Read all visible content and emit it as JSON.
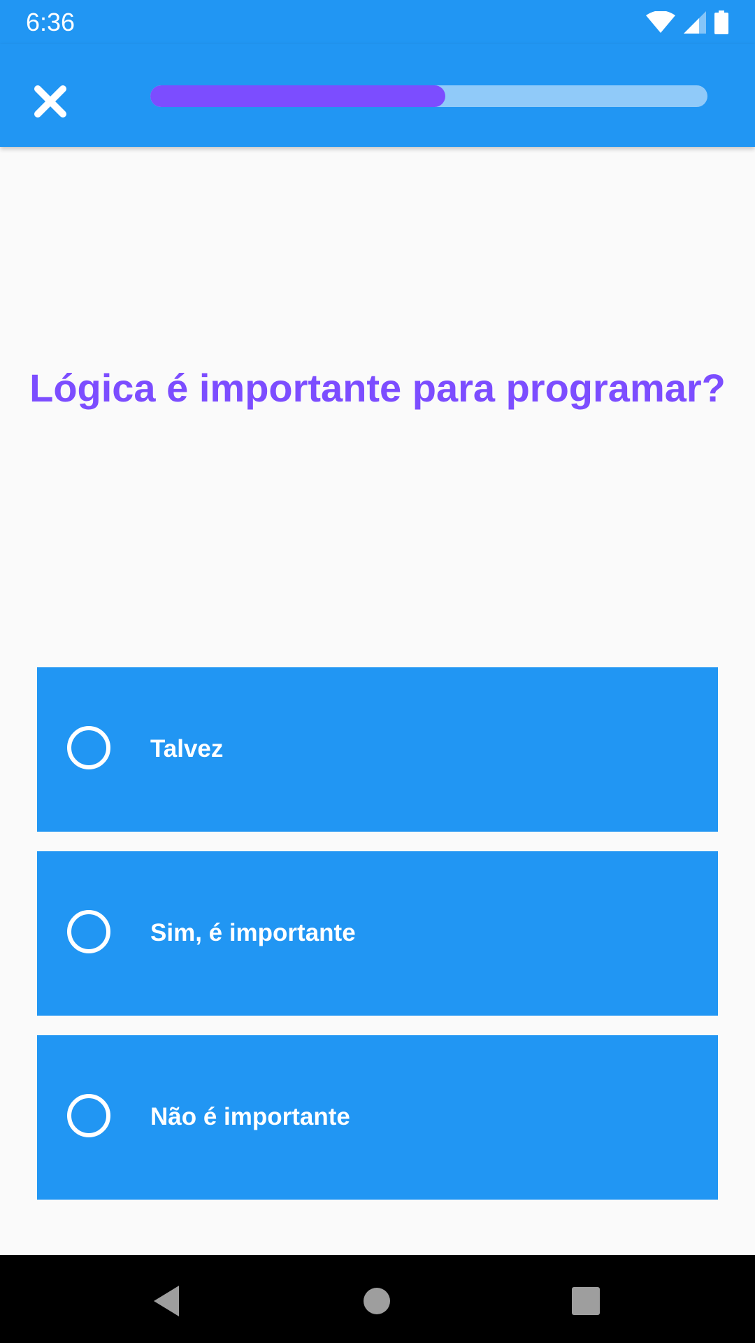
{
  "status_bar": {
    "time": "6:36",
    "icons": [
      "wifi-icon",
      "signal-icon",
      "battery-icon"
    ]
  },
  "app_bar": {
    "close_icon": "close-icon",
    "progress_fraction": 0.53,
    "progress_color": "#7c4dff",
    "progress_track_color": "#90caf9",
    "background_color": "#2196f3"
  },
  "quiz": {
    "question": "Lógica é importante para programar?",
    "question_color": "#7c4dff",
    "options": [
      {
        "label": "Talvez",
        "selected": false
      },
      {
        "label": "Sim, é importante",
        "selected": false
      },
      {
        "label": "Não é importante",
        "selected": false
      }
    ],
    "option_color": "#2196f3"
  },
  "nav_bar": {
    "buttons": [
      "back-icon",
      "home-icon",
      "recents-icon"
    ]
  }
}
